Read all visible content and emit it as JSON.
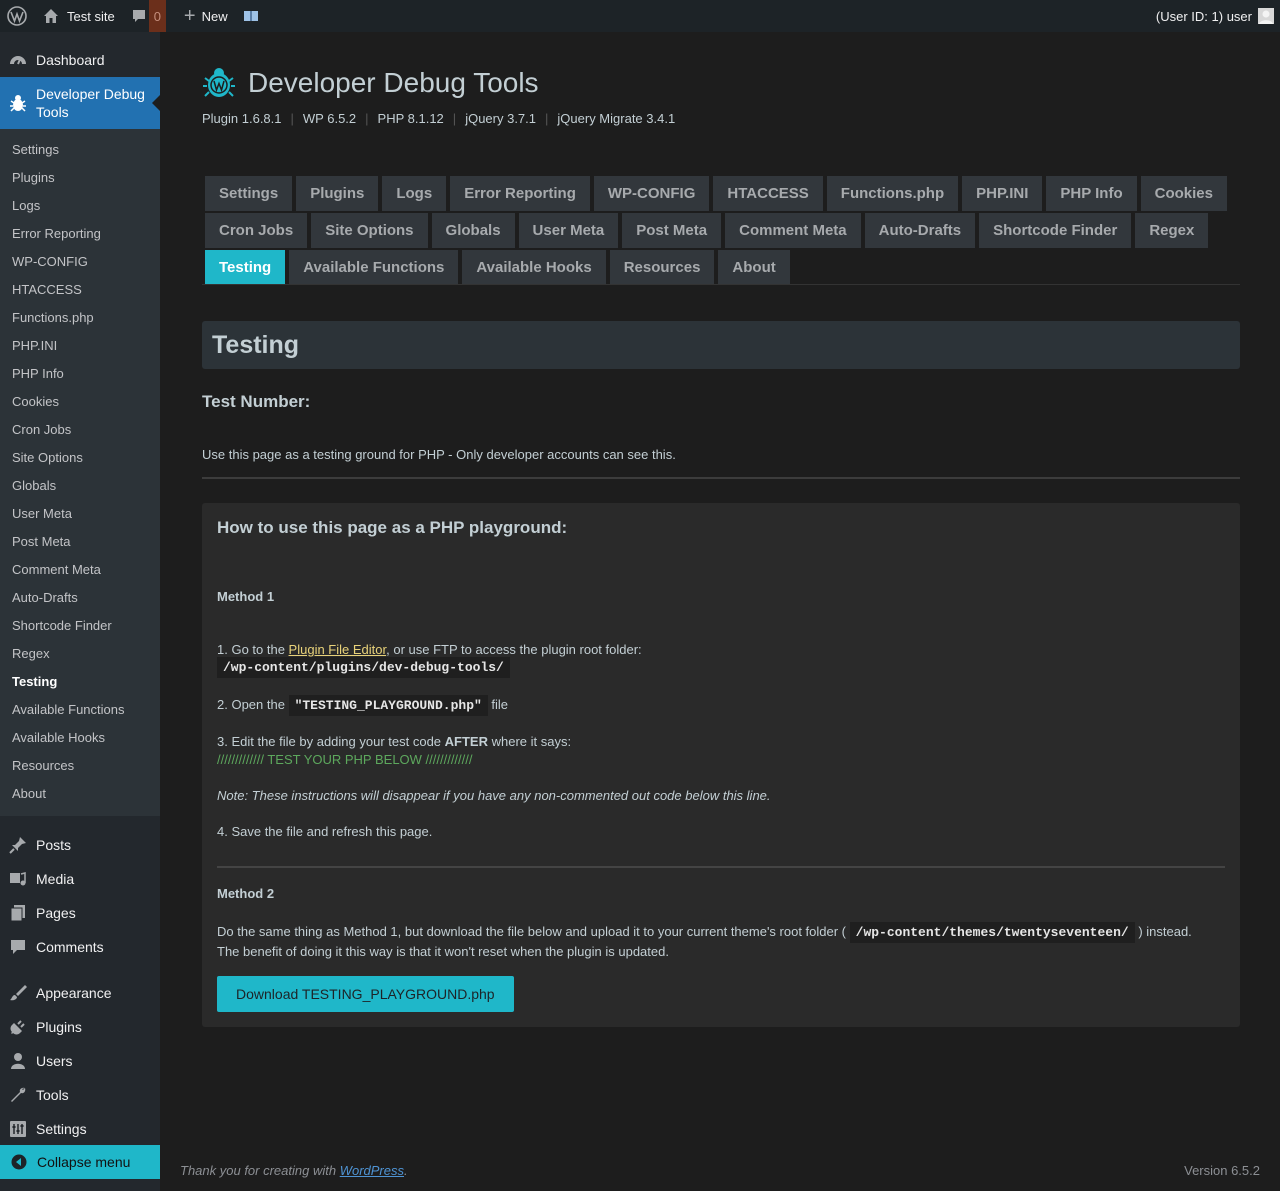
{
  "adminbar": {
    "site": "Test site",
    "comments_count": "0",
    "new_label": "New",
    "user_label": "(User ID: 1) user"
  },
  "sidebar": {
    "dashboard": "Dashboard",
    "current": "Developer Debug Tools",
    "submenu": [
      "Settings",
      "Plugins",
      "Logs",
      "Error Reporting",
      "WP-CONFIG",
      "HTACCESS",
      "Functions.php",
      "PHP.INI",
      "PHP Info",
      "Cookies",
      "Cron Jobs",
      "Site Options",
      "Globals",
      "User Meta",
      "Post Meta",
      "Comment Meta",
      "Auto-Drafts",
      "Shortcode Finder",
      "Regex",
      "Testing",
      "Available Functions",
      "Available Hooks",
      "Resources",
      "About"
    ],
    "active_sub": "Testing",
    "menu2": [
      "Posts",
      "Media",
      "Pages",
      "Comments"
    ],
    "menu3": [
      "Appearance",
      "Plugins",
      "Users",
      "Tools",
      "Settings"
    ],
    "collapse": "Collapse menu"
  },
  "header": {
    "title": "Developer Debug Tools",
    "versions": [
      "Plugin 1.6.8.1",
      "WP 6.5.2",
      "PHP 8.1.12",
      "jQuery 3.7.1",
      "jQuery Migrate 3.4.1"
    ]
  },
  "tabs": {
    "row1": [
      "Settings",
      "Plugins",
      "Logs",
      "Error Reporting",
      "WP-CONFIG",
      "HTACCESS",
      "Functions.php",
      "PHP.INI",
      "PHP Info",
      "Cookies"
    ],
    "row2": [
      "Cron Jobs",
      "Site Options",
      "Globals",
      "User Meta",
      "Post Meta",
      "Comment Meta",
      "Auto-Drafts",
      "Shortcode Finder",
      "Regex"
    ],
    "row3": [
      "Testing",
      "Available Functions",
      "Available Hooks",
      "Resources",
      "About"
    ],
    "active": "Testing"
  },
  "page": {
    "title": "Testing",
    "test_number": "Test Number:",
    "description": "Use this page as a testing ground for PHP - Only developer accounts can see this."
  },
  "panel": {
    "heading": "How to use this page as a PHP playground:",
    "method1": "Method 1",
    "step1_pre": "1. Go to the ",
    "step1_link": "Plugin File Editor",
    "step1_post": ", or use FTP to access the plugin root folder:",
    "step1_code": "/wp-content/plugins/dev-debug-tools/",
    "step2_pre": "2. Open the ",
    "step2_code": "\"TESTING_PLAYGROUND.php\"",
    "step2_post": " file",
    "step3_pre": "3. Edit the file by adding your test code ",
    "step3_bold": "AFTER",
    "step3_post": " where it says:",
    "step3_marker": "///////////// TEST YOUR PHP BELOW /////////////",
    "note": "Note: These instructions will disappear if you have any non-commented out code below this line.",
    "step4": "4. Save the file and refresh this page.",
    "method2": "Method 2",
    "m2_pre": "Do the same thing as Method 1, but download the file below and upload it to your current theme's root folder (",
    "m2_code": "/wp-content/themes/twentyseventeen/",
    "m2_post": ") instead.",
    "m2_line2": "The benefit of doing it this way is that it won't reset when the plugin is updated.",
    "download": "Download TESTING_PLAYGROUND.php"
  },
  "footer": {
    "thanks_pre": "Thank you for creating with ",
    "thanks_link": "WordPress",
    "thanks_post": ".",
    "version": "Version 6.5.2"
  }
}
